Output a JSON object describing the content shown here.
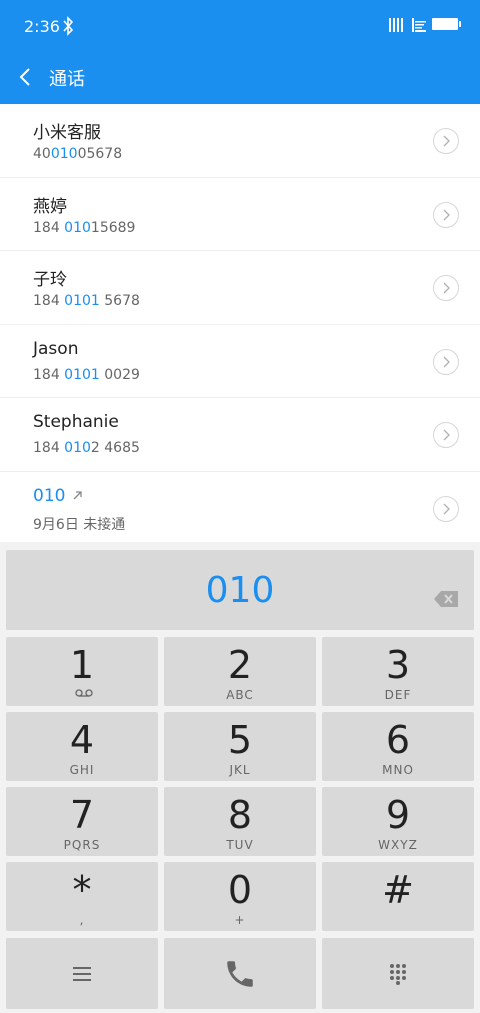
{
  "status": {
    "time": "2:36"
  },
  "header": {
    "title": "通话"
  },
  "contacts": [
    {
      "name": "小米客服",
      "num_pre": "40",
      "num_hl": "010",
      "num_post": "05678"
    },
    {
      "name": "燕婷",
      "num_pre": "184 ",
      "num_hl": "010",
      "num_post": "15689"
    },
    {
      "name": "子玲",
      "num_pre": "184 ",
      "num_hl": "0101",
      "num_post": " 5678"
    },
    {
      "name": "Jason",
      "num_pre": "184 ",
      "num_hl": "0101",
      "num_post": " 0029"
    },
    {
      "name": "Stephanie",
      "num_pre": "184 ",
      "num_hl": "010",
      "num_post": "2 4685"
    }
  ],
  "recent": {
    "number": "010",
    "detail": "9月6日 未接通"
  },
  "dialer": {
    "input": "010",
    "keys": [
      {
        "digit": "1",
        "letters": ""
      },
      {
        "digit": "2",
        "letters": "ABC"
      },
      {
        "digit": "3",
        "letters": "DEF"
      },
      {
        "digit": "4",
        "letters": "GHI"
      },
      {
        "digit": "5",
        "letters": "JKL"
      },
      {
        "digit": "6",
        "letters": "MNO"
      },
      {
        "digit": "7",
        "letters": "PQRS"
      },
      {
        "digit": "8",
        "letters": "TUV"
      },
      {
        "digit": "9",
        "letters": "WXYZ"
      },
      {
        "digit": "*",
        "letters": ","
      },
      {
        "digit": "0",
        "letters": "+"
      },
      {
        "digit": "#",
        "letters": ""
      }
    ]
  },
  "colors": {
    "accent": "#1a8ff0",
    "key_bg": "#d9d9d9"
  },
  "icons": {
    "menu": "menu-icon",
    "call": "phone-icon",
    "dialpad": "dialpad-icon",
    "backspace": "backspace-icon",
    "voicemail": "voicemail-icon"
  }
}
